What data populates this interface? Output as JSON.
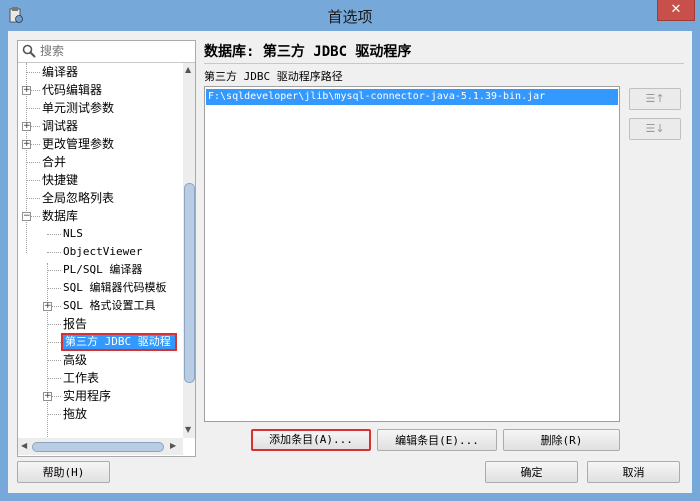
{
  "window": {
    "title": "首选项",
    "close_glyph": "✕"
  },
  "search": {
    "placeholder": "搜索"
  },
  "tree": {
    "items": [
      {
        "label": "编译器",
        "level": 0,
        "expandable": false
      },
      {
        "label": "代码编辑器",
        "level": 0,
        "expandable": true
      },
      {
        "label": "单元测试参数",
        "level": 0,
        "expandable": false
      },
      {
        "label": "调试器",
        "level": 0,
        "expandable": true
      },
      {
        "label": "更改管理参数",
        "level": 0,
        "expandable": true
      },
      {
        "label": "合并",
        "level": 0,
        "expandable": false
      },
      {
        "label": "快捷键",
        "level": 0,
        "expandable": false
      },
      {
        "label": "全局忽略列表",
        "level": 0,
        "expandable": false
      },
      {
        "label": "数据库",
        "level": 0,
        "expandable": true,
        "expanded": true
      },
      {
        "label": "NLS",
        "level": 1,
        "expandable": false
      },
      {
        "label": "ObjectViewer",
        "level": 1,
        "expandable": false
      },
      {
        "label": "PL/SQL 编译器",
        "level": 1,
        "expandable": false
      },
      {
        "label": "SQL 编辑器代码模板",
        "level": 1,
        "expandable": false
      },
      {
        "label": "SQL 格式设置工具",
        "level": 1,
        "expandable": true
      },
      {
        "label": "报告",
        "level": 1,
        "expandable": false
      },
      {
        "label": "第三方 JDBC 驱动程",
        "level": 1,
        "expandable": false,
        "selected": true
      },
      {
        "label": "高级",
        "level": 1,
        "expandable": false
      },
      {
        "label": "工作表",
        "level": 1,
        "expandable": false
      },
      {
        "label": "实用程序",
        "level": 1,
        "expandable": true
      },
      {
        "label": "拖放",
        "level": 1,
        "expandable": false
      }
    ]
  },
  "page": {
    "title": "数据库: 第三方 JDBC 驱动程序",
    "section_label": "第三方 JDBC 驱动程序路径",
    "paths": [
      "F:\\sqldeveloper\\jlib\\mysql-connector-java-5.1.39-bin.jar"
    ],
    "move_up_label": "☰↑",
    "move_down_label": "☰↓",
    "add_button": "添加条目(A)...",
    "edit_button": "编辑条目(E)...",
    "delete_button": "删除(R)"
  },
  "footer": {
    "help_button": "帮助(H)",
    "ok_button": "确定",
    "cancel_button": "取消"
  },
  "colors": {
    "title_bar": "#76a9da",
    "selection": "#3399ff",
    "highlight_border": "#d93030",
    "close_button": "#c7504b"
  }
}
